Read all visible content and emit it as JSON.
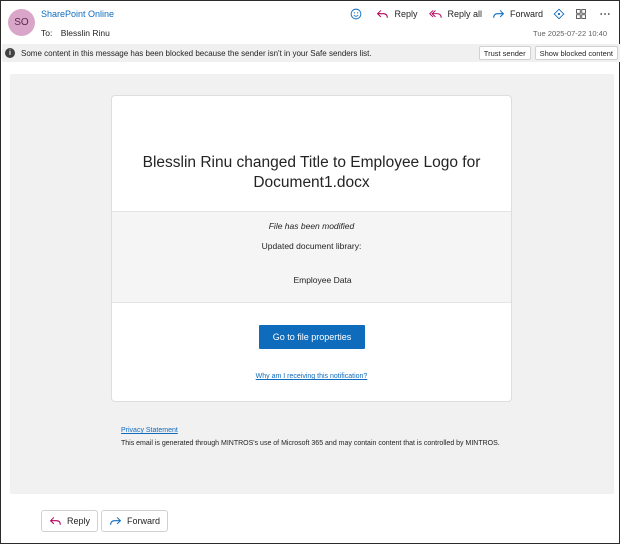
{
  "header": {
    "avatar_initials": "SO",
    "sender": "SharePoint Online",
    "to_label": "To:",
    "to_name": "Blesslin Rinu",
    "date": "Tue 2025-07-22 10:40",
    "actions": {
      "reply": "Reply",
      "reply_all": "Reply all",
      "forward": "Forward"
    }
  },
  "infobar": {
    "text": "Some content in this message has been blocked because the sender isn't in your Safe senders list.",
    "trust_sender": "Trust sender",
    "show_blocked": "Show blocked content"
  },
  "card": {
    "title": "Blesslin Rinu changed Title to Employee Logo for Document1.docx",
    "modified": "File has been modified",
    "updated_library": "Updated document library:",
    "library_name": "Employee Data",
    "cta": "Go to file properties",
    "why": "Why am I receiving this notification?"
  },
  "footer": {
    "privacy": "Privacy Statement",
    "disclaimer": "This email is generated through MINTROS's use of Microsoft 365 and may contain content that is controlled by MINTROS."
  },
  "bottom": {
    "reply": "Reply",
    "forward": "Forward"
  },
  "colors": {
    "accent": "#0f6cbd",
    "reply_icon": "#b4005a",
    "forward_icon": "#0f6cbd",
    "avatar": "#d9a6c9"
  }
}
